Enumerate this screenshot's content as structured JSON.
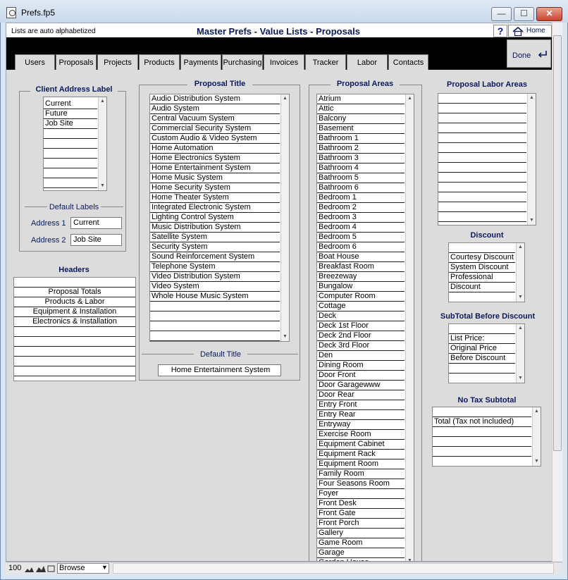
{
  "window": {
    "title": "Prefs.fp5",
    "min_glyph": "—",
    "max_glyph": "☐",
    "close_glyph": "✕"
  },
  "header": {
    "note": "Lists are auto alphabetized",
    "title": "Master Prefs - Value Lists - Proposals",
    "help_label": "?",
    "home_label": "Home",
    "done_label": "Done"
  },
  "tabs": [
    "Users",
    "Proposals",
    "Projects",
    "Products",
    "Payments",
    "Purchasing",
    "Invoices",
    "Tracker",
    "Labor",
    "Contacts"
  ],
  "client_address": {
    "title": "Client Address Label",
    "items": [
      "Current",
      "Future",
      "Job Site",
      "",
      "",
      "",
      "",
      "",
      ""
    ],
    "default_title": "Default Labels",
    "address1_label": "Address 1",
    "address1_value": "Current",
    "address2_label": "Address 2",
    "address2_value": "Job Site"
  },
  "headers": {
    "title": "Headers",
    "items": [
      "",
      "Proposal Totals",
      "Products & Labor",
      "Equipment & Installation",
      "Electronics & Installation",
      "",
      "",
      "",
      "",
      ""
    ]
  },
  "proposal_title": {
    "title": "Proposal Title",
    "items": [
      "Audio Distribution System",
      "Audio System",
      "Central Vacuum System",
      "Commercial Security System",
      "Custom Audio & Video System",
      "Home Automation",
      "Home Electronics System",
      "Home Entertainment System",
      "Home Music System",
      "Home Security System",
      "Home Theater System",
      "Integrated Electronic System",
      "Lighting Control System",
      "Music Distribution System",
      "Satellite System",
      "Security System",
      "Sound Reinforcement System",
      "Telephone System",
      "Video Distribution System",
      "Video System",
      "Whole House Music System",
      "",
      "",
      "",
      ""
    ],
    "default_title": "Default Title",
    "default_value": "Home Entertainment System"
  },
  "proposal_areas": {
    "title": "Proposal Areas",
    "items": [
      "Atrium",
      "Attic",
      "Balcony",
      "Basement",
      "Bathroom 1",
      "Bathroom 2",
      "Bathroom 3",
      "Bathroom 4",
      "Bathroom 5",
      "Bathroom 6",
      "Bedroom 1",
      "Bedroom 2",
      "Bedroom 3",
      "Bedroom 4",
      "Bedroom 5",
      "Bedroom 6",
      "Boat House",
      "Breakfast Room",
      "Breezeway",
      "Bungalow",
      "Computer Room",
      "Cottage",
      "Deck",
      "Deck 1st Floor",
      "Deck 2nd Floor",
      "Deck 3rd Floor",
      "Den",
      "Dining Room",
      "Door Front",
      "Door Garagewww",
      "Door Rear",
      "Entry Front",
      "Entry Rear",
      "Entryway",
      "Exercise Room",
      "Equipment Cabinet",
      "Equipment Rack",
      "Equipment Room",
      "Family Room",
      "Four Seasons Room",
      "Foyer",
      "Front Desk",
      "Front Gate",
      "Front Porch",
      "Gallery",
      "Game Room",
      "Garage",
      "Garden House"
    ]
  },
  "labor_areas": {
    "title": "Proposal Labor Areas",
    "items": [
      "",
      "",
      "",
      "",
      "",
      "",
      "",
      "",
      "",
      "",
      "",
      "",
      ""
    ]
  },
  "discount": {
    "title": "Discount",
    "items": [
      "",
      "Courtesy Discount",
      "System Discount",
      "Professional",
      "Discount",
      ""
    ]
  },
  "subtotal_before": {
    "title": "SubTotal Before Discount",
    "items": [
      "",
      "List Price:",
      "Original Price",
      "Before Discount",
      "",
      ""
    ]
  },
  "no_tax": {
    "title": "No Tax Subtotal",
    "items": [
      "",
      "Total (Tax not included)",
      "",
      "",
      "",
      ""
    ]
  },
  "status": {
    "zoom": "100",
    "mode": "Browse"
  }
}
